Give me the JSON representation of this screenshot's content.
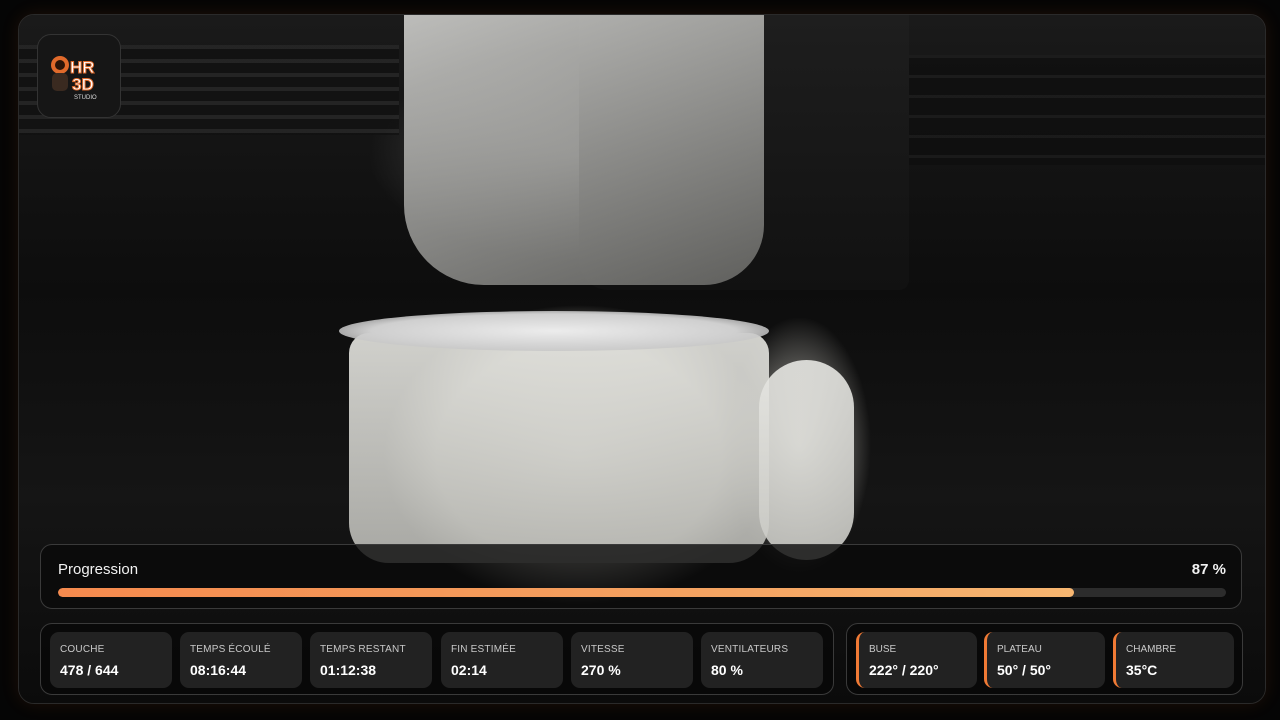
{
  "brand": {
    "logo_text_top": "HR",
    "logo_text_bottom": "3D",
    "logo_subtext": "STUDIO",
    "accent_color": "#f07a35"
  },
  "progress": {
    "label": "Progression",
    "value_text": "87 %",
    "percent": 87
  },
  "stats": [
    {
      "label": "COUCHE",
      "value": "478 / 644"
    },
    {
      "label": "TEMPS ÉCOULÉ",
      "value": "08:16:44"
    },
    {
      "label": "TEMPS RESTANT",
      "value": "01:12:38"
    },
    {
      "label": "FIN ESTIMÉE",
      "value": "02:14"
    },
    {
      "label": "VITESSE",
      "value": "270 %"
    },
    {
      "label": "VENTILATEURS",
      "value": "80 %"
    }
  ],
  "temperatures": [
    {
      "label": "BUSE",
      "value": "222° / 220°"
    },
    {
      "label": "PLATEAU",
      "value": "50° / 50°"
    },
    {
      "label": "CHAMBRE",
      "value": "35°C"
    }
  ]
}
